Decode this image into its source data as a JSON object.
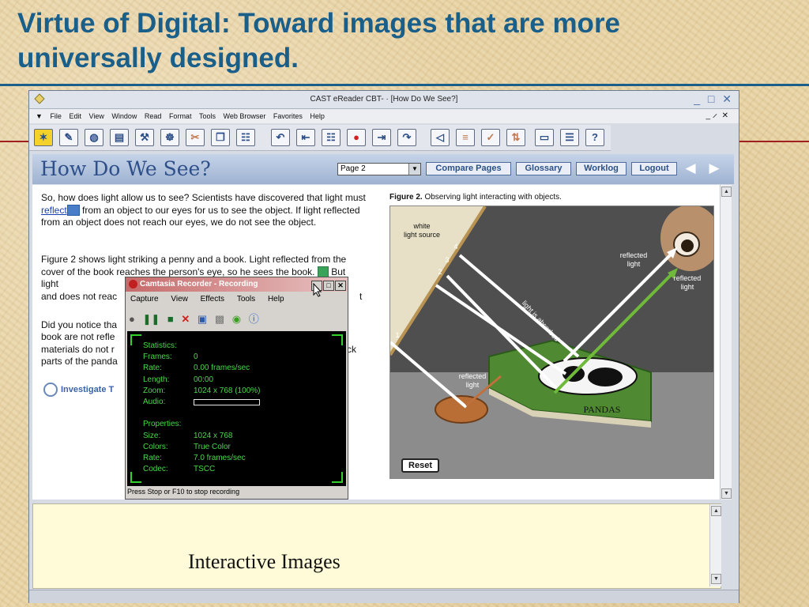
{
  "slide": {
    "title": "Virtue of Digital: Toward images that are more universally designed."
  },
  "window": {
    "title": "CAST eReader CBT- · [How Do We See?]",
    "controls": [
      "_",
      "□",
      "✕"
    ],
    "mdi_controls": "_ ̷ ✕",
    "menu": [
      "File",
      "Edit",
      "View",
      "Window",
      "Read",
      "Format",
      "Tools",
      "Web Browser",
      "Favorites",
      "Help"
    ]
  },
  "toolbar": {
    "buttons": [
      {
        "name": "home-icon",
        "glyph": "✶"
      },
      {
        "name": "notes-icon",
        "glyph": "✎"
      },
      {
        "name": "globe-icon",
        "glyph": "◍"
      },
      {
        "name": "open-folder-icon",
        "glyph": "▤"
      },
      {
        "name": "cabinet-icon",
        "glyph": "⚒"
      },
      {
        "name": "tools-icon",
        "glyph": "☸"
      },
      {
        "name": "scissors-icon",
        "glyph": "✂"
      },
      {
        "name": "copy-icon",
        "glyph": "❐"
      },
      {
        "name": "paste-icon",
        "glyph": "☷"
      },
      {
        "name": "undo-icon",
        "glyph": "↶"
      },
      {
        "name": "skip-back-icon",
        "glyph": "⇤"
      },
      {
        "name": "speech-bubble-icon",
        "glyph": "☷"
      },
      {
        "name": "stop-icon",
        "glyph": "●"
      },
      {
        "name": "skip-forward-icon",
        "glyph": "⇥"
      },
      {
        "name": "redo-icon",
        "glyph": "↷"
      },
      {
        "name": "speaker-icon",
        "glyph": "◁"
      },
      {
        "name": "book-icon",
        "glyph": "≡"
      },
      {
        "name": "spellcheck-icon",
        "glyph": "✓"
      },
      {
        "name": "sort-az-icon",
        "glyph": "⇅"
      },
      {
        "name": "card-icon",
        "glyph": "▭"
      },
      {
        "name": "list-icon",
        "glyph": "☰"
      },
      {
        "name": "help-icon",
        "glyph": "?"
      }
    ]
  },
  "banner": {
    "title": "How Do We See?",
    "page_select": "Page 2",
    "buttons": [
      "Compare Pages",
      "Glossary",
      "Worklog",
      "Logout"
    ]
  },
  "content": {
    "para1_a": "So, how does light allow us to see? Scientists have discovered that light must ",
    "para1_link": "reflect",
    "para1_b": " from an object to our eyes for us to see the object. If light reflected from an object does not reach our eyes, we do not see the object.",
    "para2_a": "Figure 2 shows light striking a penny and a book. Light reflected from the cover of the book reaches the person's eye, so he sees the book.",
    "para2_b": " But light",
    "para2_c": "t",
    "para2_d": "and does not reac",
    "para3_a": "Did you notice tha",
    "para3_b": "book are not refle",
    "para3_c": "materials do not r",
    "para3_c2": "ck",
    "para3_d": "parts of the panda",
    "investigate": "Investigate T"
  },
  "figure": {
    "caption_bold": "Figure 2.",
    "caption_rest": " Observing light interacting with objects.",
    "labels": {
      "white_light": "white\nlight source",
      "reflected_1": "reflected\nlight",
      "reflected_2": "reflected\nlight",
      "reflected_3": "reflected\nlight",
      "absorbed": "light is absorbed",
      "book": "PANDAS",
      "n1": "1",
      "n2": "2",
      "n3": "3",
      "n4": "4"
    },
    "reset": "Reset"
  },
  "bottom": {
    "caption": "Interactive Images"
  },
  "camtasia": {
    "title": "Camtasia Recorder - Recording",
    "menu": [
      "Capture",
      "View",
      "Effects",
      "Tools",
      "Help"
    ],
    "stats": [
      {
        "k": "Statistics:",
        "v": ""
      },
      {
        "k": "Frames:",
        "v": "0"
      },
      {
        "k": "Rate:",
        "v": "0.00 frames/sec"
      },
      {
        "k": "Length:",
        "v": "00:00"
      },
      {
        "k": "Zoom:",
        "v": "1024 x 768 (100%)"
      },
      {
        "k": "Audio:",
        "v": ""
      },
      {
        "k": "",
        "v": ""
      },
      {
        "k": "Properties:",
        "v": ""
      },
      {
        "k": "Size:",
        "v": "1024 x 768"
      },
      {
        "k": "Colors:",
        "v": "True Color"
      },
      {
        "k": "Rate:",
        "v": "7.0 frames/sec"
      },
      {
        "k": "Codec:",
        "v": "TSCC"
      }
    ],
    "status": "Press Stop or F10 to stop recording"
  },
  "colors": {
    "title_blue": "#1a5f8a",
    "rule_red": "#a02020",
    "stat_green": "#49d84a",
    "book_green": "#4f8a32"
  }
}
